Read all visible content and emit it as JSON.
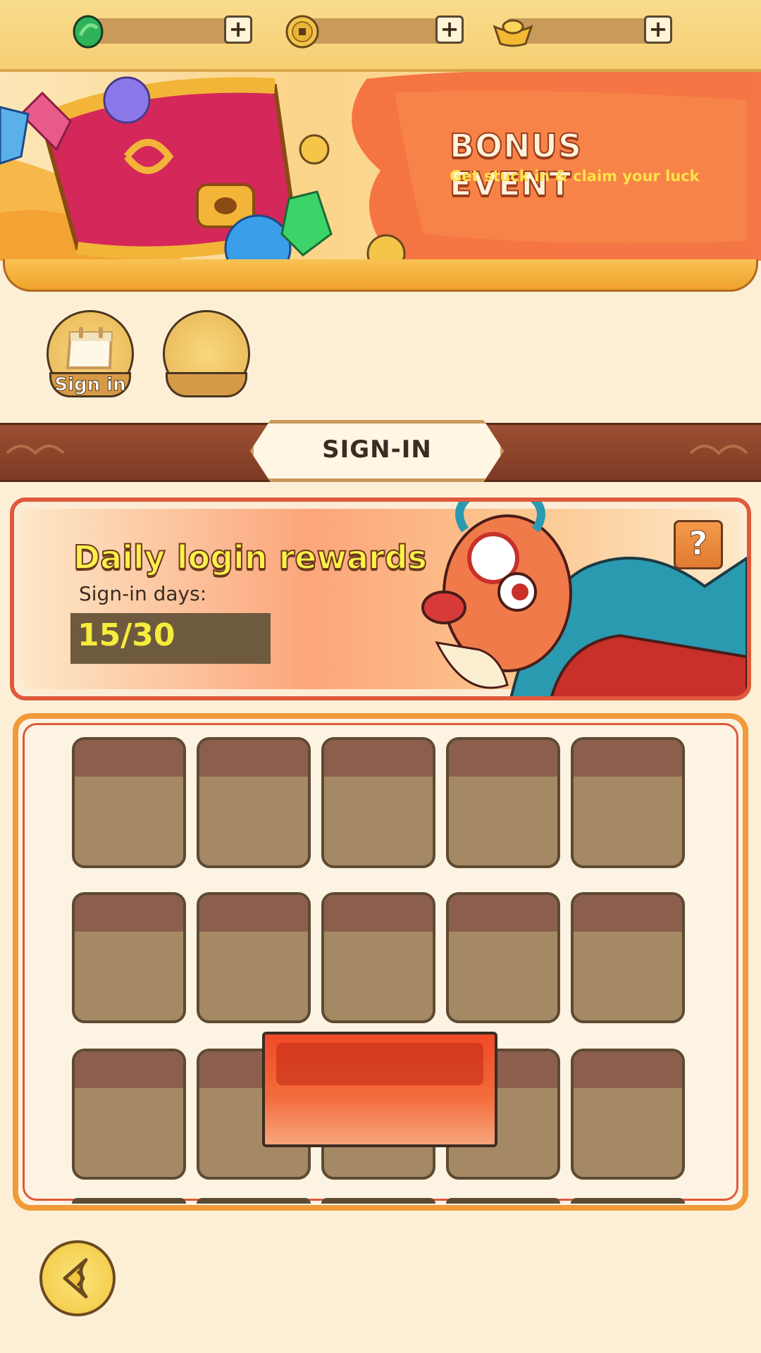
{
  "currency": [
    {
      "icon": "green-gem-icon",
      "plus_label": "+"
    },
    {
      "icon": "gold-coin-icon",
      "plus_label": "+"
    },
    {
      "icon": "gold-ingot-icon",
      "plus_label": "+"
    }
  ],
  "banner": {
    "title": "BONUS EVENT",
    "subtitle": "Get stuck in & claim your luck"
  },
  "tabs": [
    {
      "label": "Sign in",
      "icon": "calendar-icon"
    },
    {
      "label": "",
      "icon": ""
    }
  ],
  "section": {
    "title": "SIGN-IN"
  },
  "daily": {
    "title": "Daily login rewards",
    "days_label": "Sign-in days:",
    "days_value": "15/30",
    "help_label": "?"
  },
  "back": {
    "icon": "back-arrow-icon"
  },
  "colors": {
    "accent_orange": "#f09a3a",
    "accent_red": "#e0593a",
    "slot_fill": "#a58964",
    "slot_top": "#8b5e4e",
    "title_yellow": "#fbf14a"
  }
}
